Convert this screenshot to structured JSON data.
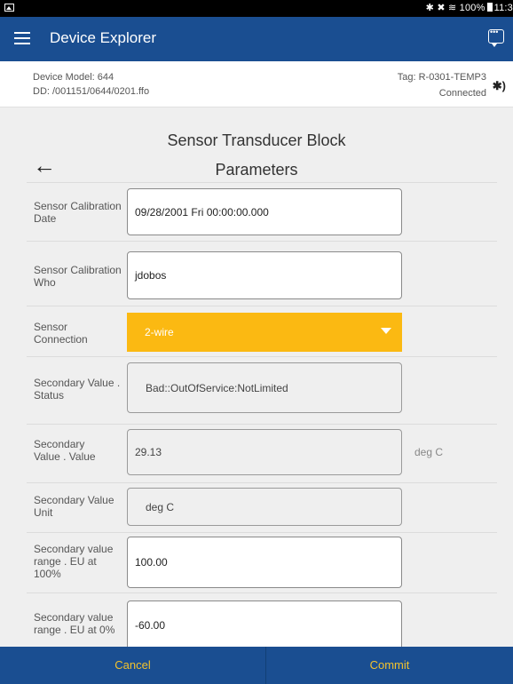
{
  "status_bar": {
    "right_text": "✱ ✖ ≋ 100%",
    "time": "11:3"
  },
  "app_bar": {
    "title": "Device Explorer",
    "menu_icon": "hamburger-menu-icon",
    "chat_icon": "chat-bubble-icon"
  },
  "device": {
    "model": "Device Model: 644",
    "dd": "DD: /001151/0644/0201.ffo",
    "tag": "Tag: R-0301-TEMP3",
    "connection": "Connected",
    "bluetooth_icon": "bluetooth-icon"
  },
  "header": {
    "block_title": "Sensor Transducer Block",
    "params_title": "Parameters",
    "back_arrow": "←"
  },
  "params": [
    {
      "label": "Sensor Calibration Date",
      "value": "09/28/2001 Fri 00:00:00.000",
      "kind": "input"
    },
    {
      "label": "Sensor Calibration Who",
      "value": "jdobos",
      "kind": "input"
    },
    {
      "label": "Sensor Connection",
      "value": "2-wire",
      "kind": "select"
    },
    {
      "label": "Secondary Value . Status",
      "value": "Bad::OutOfService:NotLimited",
      "kind": "readonly"
    },
    {
      "label": "Secondary Value . Value",
      "value": "29.13",
      "kind": "input",
      "unit": "deg C"
    },
    {
      "label": "Secondary Value Unit",
      "value": "deg C",
      "kind": "readonly"
    },
    {
      "label": "Secondary value range . EU at 100%",
      "value": "100.00",
      "kind": "input"
    },
    {
      "label": "Secondary value range . EU at 0%",
      "value": "-60.00",
      "kind": "input"
    }
  ],
  "actions": {
    "cancel": "Cancel",
    "commit": "Commit"
  },
  "colors": {
    "primary": "#1a4e91",
    "accent": "#fbb912",
    "action_text": "#f2c22d"
  }
}
